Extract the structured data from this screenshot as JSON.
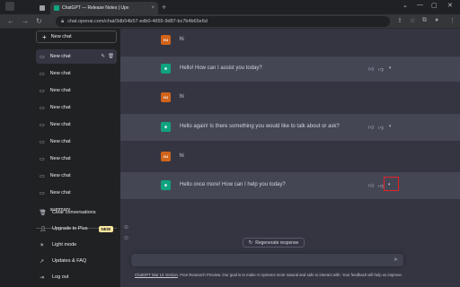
{
  "browser": {
    "tabs": [
      {
        "label": ""
      },
      {
        "label": "ChatGPT — Release Notes | Upv"
      }
    ],
    "close_glyph": "×",
    "new_tab_glyph": "+",
    "url": "chat.openai.com/chat/3db54b57-edb0-4655-9d87-bc7b4b65e6d"
  },
  "sidebar": {
    "new_chat_label": "New chat",
    "chats": [
      {
        "label": "New chat"
      },
      {
        "label": "New chat"
      },
      {
        "label": "New chat"
      },
      {
        "label": "New chat"
      },
      {
        "label": "New chat"
      },
      {
        "label": "New chat"
      },
      {
        "label": "New chat"
      },
      {
        "label": "New chat"
      },
      {
        "label": "New chat"
      },
      {
        "label": "summary"
      }
    ],
    "menu": [
      {
        "label": "Clear conversations",
        "icon": "trash-icon"
      },
      {
        "label": "Upgrade to Plus",
        "icon": "user-icon",
        "badge": "NEW"
      },
      {
        "label": "Light mode",
        "icon": "sun-icon"
      },
      {
        "label": "Updates & FAQ",
        "icon": "external-link-icon"
      },
      {
        "label": "Log out",
        "icon": "logout-icon"
      }
    ]
  },
  "conversation": {
    "user_avatar": "HJ",
    "messages": [
      {
        "role": "user",
        "text": "hi"
      },
      {
        "role": "assistant",
        "text": "Hello! How can I assist you today?"
      },
      {
        "role": "user",
        "text": "hi"
      },
      {
        "role": "assistant",
        "text": "Hello again! Is there something you would like to talk about or ask?"
      },
      {
        "role": "user",
        "text": "hi"
      },
      {
        "role": "assistant",
        "text": "Hello once more! How can I help you today?"
      }
    ]
  },
  "composer": {
    "regenerate_label": "Regenerate response"
  },
  "footer": {
    "link_text": "ChatGPT Mar 14 Version",
    "text": ". Free Research Preview. Our goal is to make AI systems more natural and safe to interact with. Your feedback will help us improve."
  },
  "colors": {
    "sidebar_bg": "#202123",
    "main_bg": "#343541",
    "assistant_row_bg": "#444654",
    "accent_green": "#10a37f",
    "user_avatar_bg": "#d0641b",
    "highlight_red": "#e0242b"
  }
}
